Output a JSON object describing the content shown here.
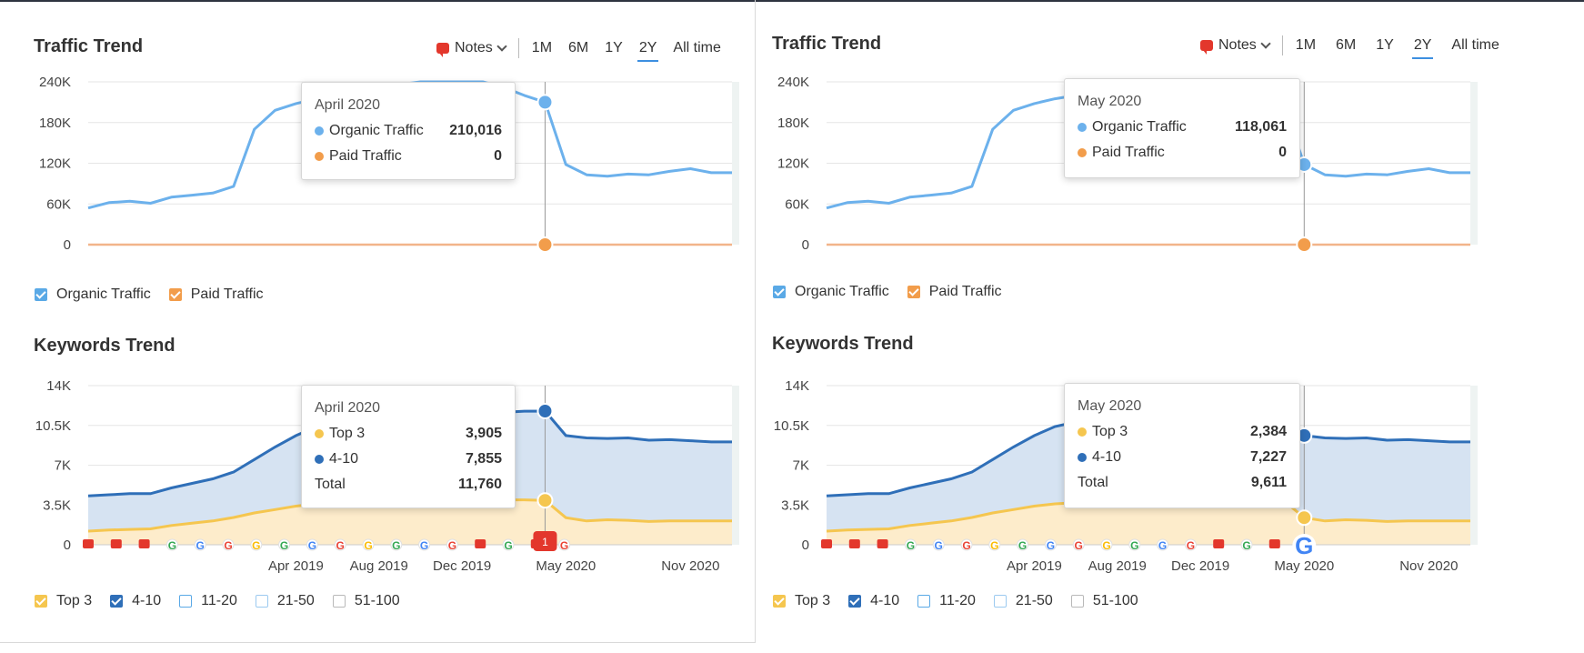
{
  "colors": {
    "organic": "#6cb1ec",
    "paid": "#f29d4b",
    "top3": "#f5c64f",
    "r410": "#2f6fb8",
    "r1120": "#5aa9e6",
    "r2150": "#9ccaf0",
    "r51100": "#b9b9b9",
    "grid": "#e6e6e6",
    "note": "#e3372c"
  },
  "panels": [
    {
      "traffic": {
        "title": "Traffic Trend",
        "notes_label": "Notes",
        "ranges": [
          "1M",
          "6M",
          "1Y",
          "2Y",
          "All time"
        ],
        "active_range": "2Y",
        "tooltip": {
          "date": "April 2020",
          "rows": [
            {
              "label": "Organic Traffic",
              "value": "210,016"
            },
            {
              "label": "Paid Traffic",
              "value": "0"
            }
          ]
        },
        "legend": [
          {
            "label": "Organic Traffic",
            "checked": true
          },
          {
            "label": "Paid Traffic",
            "checked": true
          }
        ]
      },
      "keywords": {
        "title": "Keywords Trend",
        "tooltip": {
          "date": "April 2020",
          "rows": [
            {
              "label": "Top 3",
              "value": "3,905"
            },
            {
              "label": "4-10",
              "value": "7,855"
            },
            {
              "label": "Total",
              "value": "11,760"
            }
          ]
        },
        "legend": [
          {
            "label": "Top 3",
            "checked": true
          },
          {
            "label": "4-10",
            "checked": true
          },
          {
            "label": "11-20",
            "checked": false
          },
          {
            "label": "21-50",
            "checked": false
          },
          {
            "label": "51-100",
            "checked": false
          }
        ],
        "note_badge": "1"
      }
    },
    {
      "traffic": {
        "title": "Traffic Trend",
        "notes_label": "Notes",
        "ranges": [
          "1M",
          "6M",
          "1Y",
          "2Y",
          "All time"
        ],
        "active_range": "2Y",
        "tooltip": {
          "date": "May 2020",
          "rows": [
            {
              "label": "Organic Traffic",
              "value": "118,061"
            },
            {
              "label": "Paid Traffic",
              "value": "0"
            }
          ]
        },
        "legend": [
          {
            "label": "Organic Traffic",
            "checked": true
          },
          {
            "label": "Paid Traffic",
            "checked": true
          }
        ]
      },
      "keywords": {
        "title": "Keywords Trend",
        "tooltip": {
          "date": "May 2020",
          "rows": [
            {
              "label": "Top 3",
              "value": "2,384"
            },
            {
              "label": "4-10",
              "value": "7,227"
            },
            {
              "label": "Total",
              "value": "9,611"
            }
          ]
        },
        "legend": [
          {
            "label": "Top 3",
            "checked": true
          },
          {
            "label": "4-10",
            "checked": true
          },
          {
            "label": "11-20",
            "checked": false
          },
          {
            "label": "21-50",
            "checked": false
          },
          {
            "label": "51-100",
            "checked": false
          }
        ],
        "note_badge": ""
      }
    }
  ],
  "chart_data": [
    {
      "type": "line",
      "title": "Traffic Trend",
      "x_ticks_printed": [],
      "y_ticks": [
        "0",
        "60K",
        "120K",
        "180K",
        "240K"
      ],
      "ylim": [
        0,
        240000
      ],
      "grid": true,
      "x_months": [
        "Jun 2018",
        "Jul 2018",
        "Aug 2018",
        "Sep 2018",
        "Oct 2018",
        "Nov 2018",
        "Dec 2018",
        "Jan 2019",
        "Feb 2019",
        "Mar 2019",
        "Apr 2019",
        "May 2019",
        "Jun 2019",
        "Jul 2019",
        "Aug 2019",
        "Sep 2019",
        "Oct 2019",
        "Nov 2019",
        "Dec 2019",
        "Jan 2020",
        "Feb 2020",
        "Mar 2020",
        "Apr 2020",
        "May 2020",
        "Jun 2020",
        "Jul 2020",
        "Aug 2020",
        "Sep 2020",
        "Oct 2020",
        "Nov 2020",
        "Dec 2020",
        "Jan 2021"
      ],
      "series": [
        {
          "name": "Organic Traffic",
          "values": [
            54000,
            62000,
            64000,
            61000,
            70000,
            73000,
            76000,
            86000,
            170000,
            198000,
            208000,
            215000,
            220000,
            226000,
            230000,
            236000,
            240000,
            240000,
            240000,
            240000,
            232000,
            220000,
            210016,
            118061,
            103000,
            101000,
            104000,
            103000,
            108000,
            112000,
            106000,
            106000
          ]
        },
        {
          "name": "Paid Traffic",
          "values": [
            0,
            0,
            0,
            0,
            0,
            0,
            0,
            0,
            0,
            0,
            0,
            0,
            0,
            0,
            0,
            0,
            0,
            0,
            0,
            0,
            0,
            0,
            0,
            0,
            0,
            0,
            0,
            0,
            0,
            0,
            0,
            0
          ]
        }
      ],
      "legend": "bottom-left"
    },
    {
      "type": "area",
      "title": "Keywords Trend",
      "x_ticks": [
        "Apr 2019",
        "Aug 2019",
        "Dec 2019",
        "May 2020",
        "Nov 2020"
      ],
      "y_ticks": [
        "0",
        "3.5K",
        "7K",
        "10.5K",
        "14K"
      ],
      "ylim": [
        0,
        14000
      ],
      "grid": true,
      "x_months": [
        "Jun 2018",
        "Jul 2018",
        "Aug 2018",
        "Sep 2018",
        "Oct 2018",
        "Nov 2018",
        "Dec 2018",
        "Jan 2019",
        "Feb 2019",
        "Mar 2019",
        "Apr 2019",
        "May 2019",
        "Jun 2019",
        "Jul 2019",
        "Aug 2019",
        "Sep 2019",
        "Oct 2019",
        "Nov 2019",
        "Dec 2019",
        "Jan 2020",
        "Feb 2020",
        "Mar 2020",
        "Apr 2020",
        "May 2020",
        "Jun 2020",
        "Jul 2020",
        "Aug 2020",
        "Sep 2020",
        "Oct 2020",
        "Nov 2020",
        "Dec 2020",
        "Jan 2021"
      ],
      "series": [
        {
          "name": "Top 3",
          "values": [
            1200,
            1300,
            1350,
            1400,
            1700,
            1900,
            2100,
            2400,
            2800,
            3100,
            3400,
            3600,
            3700,
            3800,
            3800,
            3850,
            3900,
            3900,
            3950,
            3950,
            3950,
            3950,
            3905,
            2384,
            2100,
            2200,
            2150,
            2050,
            2100,
            2100,
            2100,
            2100
          ]
        },
        {
          "name": "4-10",
          "values": [
            3100,
            3100,
            3150,
            3100,
            3300,
            3500,
            3700,
            4000,
            4700,
            5500,
            6200,
            6800,
            7100,
            7300,
            7400,
            7450,
            7500,
            7550,
            7600,
            7650,
            7700,
            7800,
            7855,
            7227,
            7300,
            7150,
            7250,
            7150,
            7150,
            7050,
            6950,
            6950
          ]
        }
      ],
      "legend": "bottom-left"
    }
  ]
}
